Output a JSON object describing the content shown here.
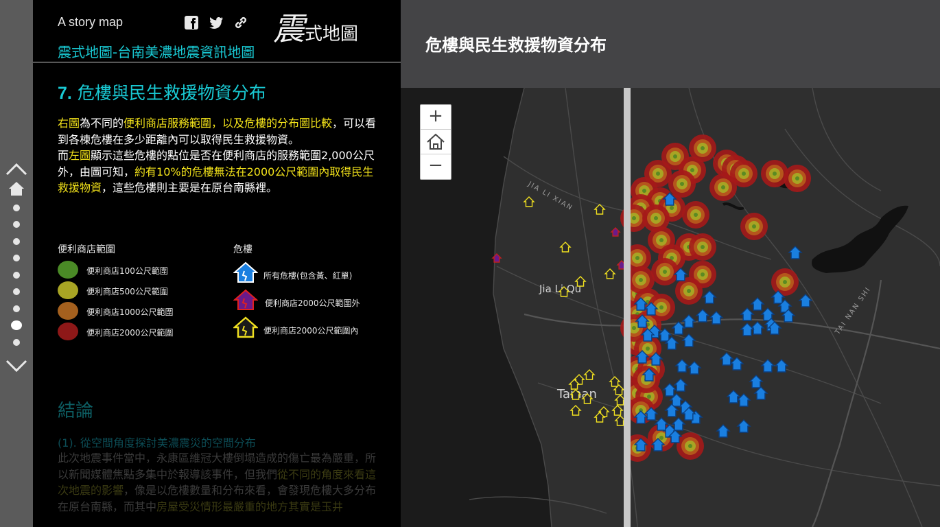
{
  "story": {
    "label": "A story map",
    "logo_big": "震",
    "logo_rest": "式地圖",
    "subtitle": "震式地圖-台南美濃地震資訊地圖"
  },
  "share_icons": [
    "facebook-icon",
    "twitter-icon",
    "link-icon"
  ],
  "section": {
    "number": "7.",
    "title": "危樓與民生救援物資分布",
    "p1_a": "右圖",
    "p1_b": "為不同的",
    "p1_c": "便利商店服務範圍，以及危樓的分布圖比較",
    "p1_d": "，可以看到各棟危樓在多少距離內可以取得民生救援物資。",
    "p2_a": "而",
    "p2_b": "左圖",
    "p2_c": "顯示這些危樓的點位是否在便利商店的服務範圍2,000公尺外，由圖可知，",
    "p2_d": "約有10%的危樓無法在2000公尺範圍內取得民生救援物資",
    "p2_e": "，這些危樓則主要是在原台南縣裡。"
  },
  "legend": {
    "store_head": "便利商店範圍",
    "store_items": [
      {
        "label": "便利商店100公尺範圍",
        "color": "#4a8a26"
      },
      {
        "label": "便利商店500公尺範圍",
        "color": "#a8a424"
      },
      {
        "label": "便利商店1000公尺範圍",
        "color": "#a4601e"
      },
      {
        "label": "便利商店2000公尺範圍",
        "color": "#8e1818"
      }
    ],
    "building_head": "危樓",
    "building_items": [
      {
        "label": "所有危樓(包含黃、紅單)",
        "color": "#1a7fe0"
      },
      {
        "label": "便利商店2000公尺範圍外",
        "color": "#6a1a8a"
      },
      {
        "label": "便利商店2000公尺範圍內",
        "color": "#f0e020"
      }
    ]
  },
  "conclusion": {
    "heading": "結論",
    "sub": "(1). 從空間角度探討美濃震災的空間分布",
    "body_a": "此次地震事件當中，永康區維冠大樓倒塌造成的傷亡最為嚴重，所以新聞媒體焦點多集中於報導該事件，但我們",
    "body_hl": "從不同的角度來看這次地震的影響",
    "body_b": "，像是以危樓數量和分布來看，會發現危樓大多分布在原台南縣，而其中",
    "body_hl2": "房屋受災情形最嚴重的地方其實是玉井"
  },
  "map": {
    "title": "危樓與民生救援物資分布",
    "zoom_in": "+",
    "zoom_out": "−",
    "labels": {
      "jia_li": "Jia Li Qu",
      "tainan": "Tainan",
      "jiali_xian": "JIA LI XIAN",
      "tainan_shi": "TAI NAN SHI"
    }
  },
  "colors": {
    "accent": "#19c9d3",
    "highlight": "#f2e21a"
  }
}
